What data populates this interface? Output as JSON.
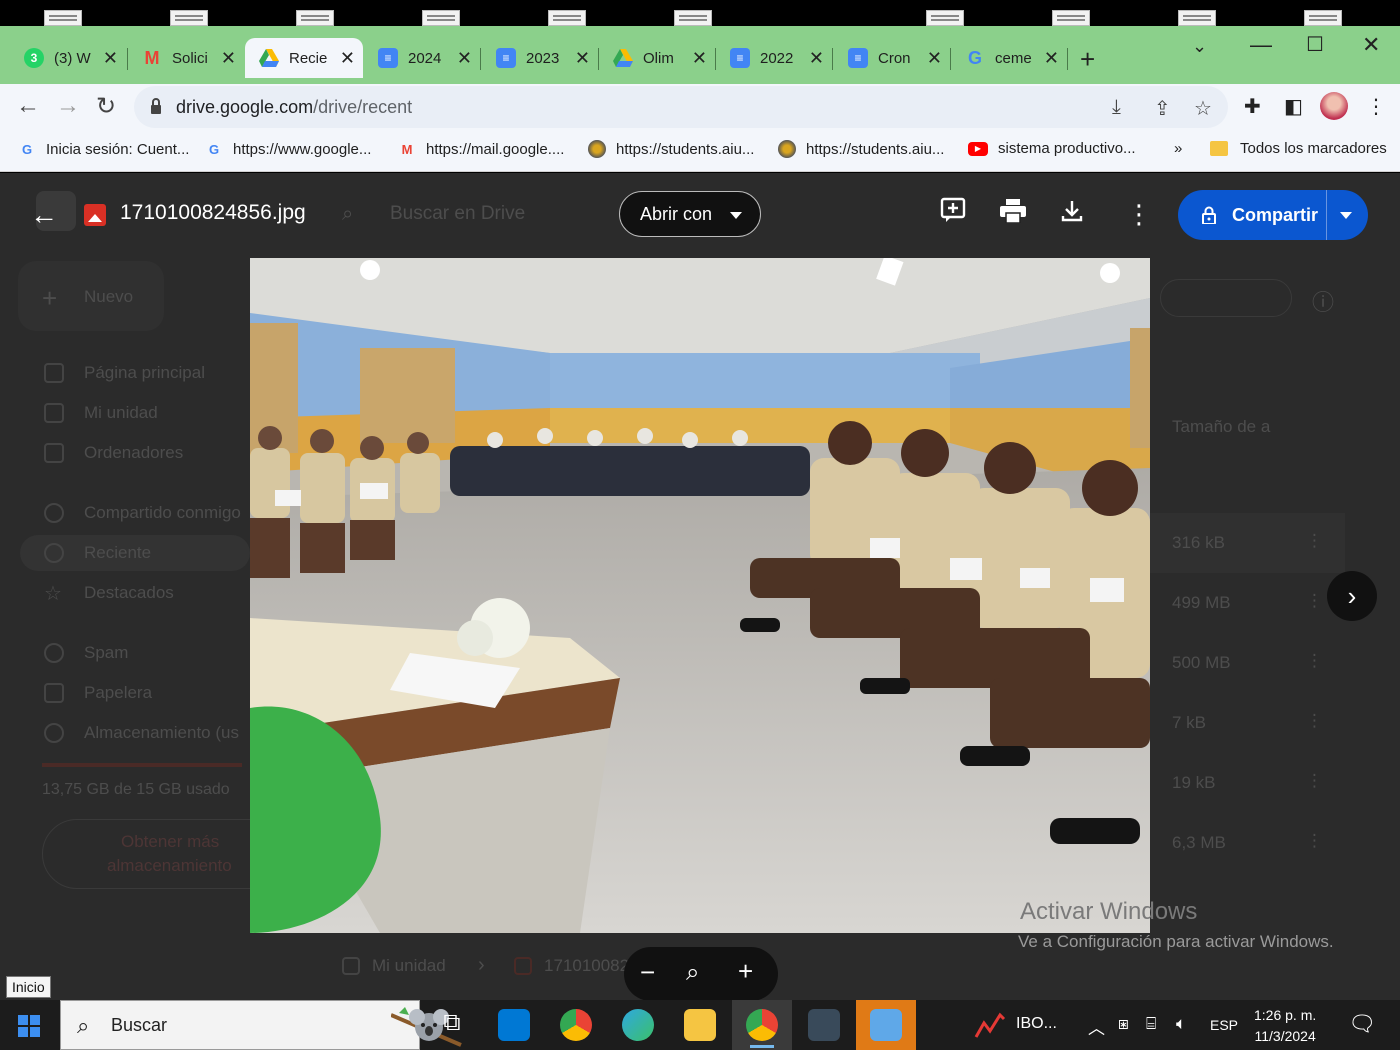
{
  "browser": {
    "tabs": [
      {
        "label": "(3) W",
        "favicon": "whatsapp-icon",
        "color": "#25d366"
      },
      {
        "label": "Solici",
        "favicon": "gmail-icon",
        "color": "#ea4335"
      },
      {
        "label": "Recie",
        "favicon": "drive-icon",
        "color": "#34a853",
        "active": true
      },
      {
        "label": "2024",
        "favicon": "docs-icon",
        "color": "#4285f4"
      },
      {
        "label": "2023",
        "favicon": "docs-icon",
        "color": "#4285f4"
      },
      {
        "label": "Olim",
        "favicon": "drive-icon",
        "color": "#34a853"
      },
      {
        "label": "2022",
        "favicon": "docs-icon",
        "color": "#4285f4"
      },
      {
        "label": "Cron",
        "favicon": "docs-icon",
        "color": "#4285f4"
      },
      {
        "label": "ceme",
        "favicon": "google-icon",
        "color": "#4285f4"
      }
    ],
    "url_host": "drive.google.com",
    "url_path": "/drive/recent",
    "bookmarks": [
      {
        "label": "Inicia sesión: Cuent...",
        "icon": "google-icon"
      },
      {
        "label": "https://www.google...",
        "icon": "google-icon"
      },
      {
        "label": "https://mail.google....",
        "icon": "gmail-icon"
      },
      {
        "label": "https://students.aiu...",
        "icon": "aiu-icon"
      },
      {
        "label": "https://students.aiu...",
        "icon": "aiu-icon"
      },
      {
        "label": "sistema productivo...",
        "icon": "youtube-icon"
      }
    ],
    "bookmarks_overflow": "»",
    "all_bookmarks": "Todos los marcadores"
  },
  "drive_bg": {
    "search_placeholder": "Buscar en Drive",
    "new_label": "Nuevo",
    "nav": [
      "Página principal",
      "Mi unidad",
      "Ordenadores",
      "Compartido conmigo",
      "Reciente",
      "Destacados",
      "Spam",
      "Papelera",
      "Almacenamiento (us"
    ],
    "storage_text": "13,75 GB de 15 GB usado",
    "get_more_line1": "Obtener más",
    "get_more_line2": "almacenamiento",
    "size_header": "Tamaño de a",
    "sizes": [
      "316 kB",
      "499 MB",
      "500 MB",
      "7 kB",
      "19 kB",
      "6,3 MB"
    ],
    "breadcrumb_root": "Mi unidad",
    "breadcrumb_file": "171010082"
  },
  "viewer": {
    "filename": "1710100824856.jpg",
    "open_with": "Abrir con",
    "share": "Compartir"
  },
  "watermark": {
    "line1": "Activar Windows",
    "line2": "Ve a Configuración para activar Windows."
  },
  "taskbar": {
    "tooltip": "Inicio",
    "search": "Buscar",
    "ibo": "IBO...",
    "lang": "ESP",
    "time": "1:26 p. m.",
    "date": "11/3/2024"
  }
}
